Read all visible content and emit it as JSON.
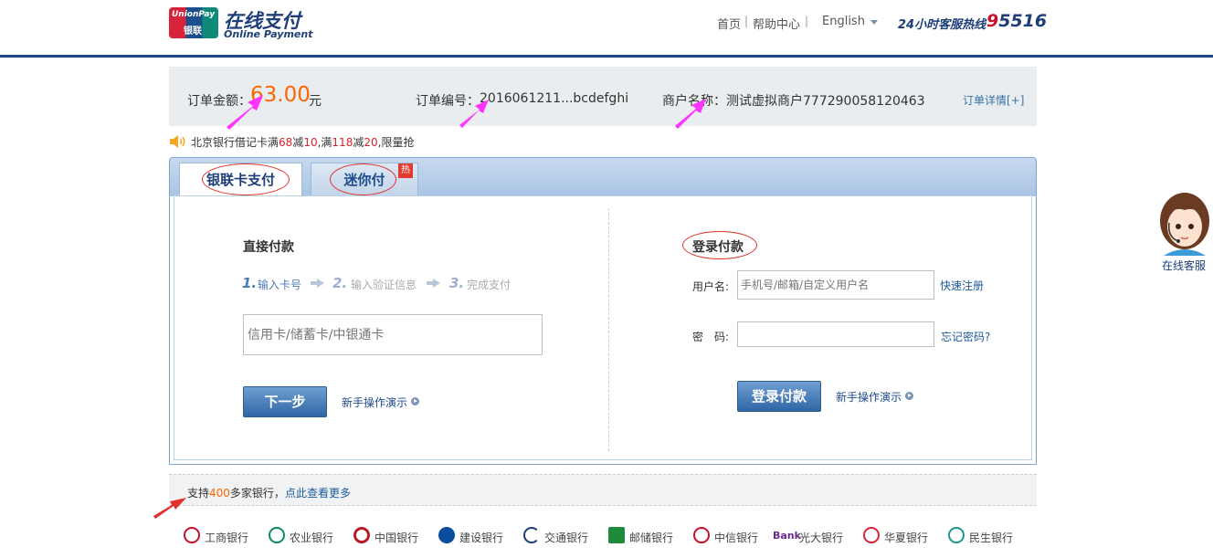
{
  "header": {
    "logo_line1": "UnionPay",
    "logo_line2": "银联",
    "brand_title": "在线支付",
    "brand_subtitle": "Online Payment",
    "nav_home": "首页",
    "nav_help": "帮助中心",
    "nav_lang": "English",
    "hotline_label": "24小时客服热线",
    "hotline_number": "95516"
  },
  "order": {
    "amount_label": "订单金额：",
    "amount_value": "63.00",
    "amount_unit": "元",
    "number_label": "订单编号：",
    "number_value": "2016061211...bcdefghi",
    "merchant_label": "商户名称：",
    "merchant_value": "测试虚拟商户777290058120463",
    "details_link": "订单详情[+]"
  },
  "promo": {
    "text_1": "北京银行借记卡满",
    "n1": "68",
    "text_2": "减",
    "n2": "10",
    "text_3": ",满",
    "n3": "118",
    "text_4": "减",
    "n4": "20",
    "text_5": ",限量抢"
  },
  "tabs": [
    {
      "label": "银联卡支付",
      "active": true
    },
    {
      "label": "迷你付",
      "active": false,
      "badge": "热"
    }
  ],
  "direct_pay": {
    "title": "直接付款",
    "steps": [
      {
        "num": "1.",
        "label": "输入卡号",
        "active": true
      },
      {
        "num": "2.",
        "label": "输入验证信息",
        "active": false
      },
      {
        "num": "3.",
        "label": "完成支付",
        "active": false
      }
    ],
    "card_placeholder": "信用卡/储蓄卡/中银通卡",
    "next_button": "下一步",
    "demo_link": "新手操作演示"
  },
  "login_pay": {
    "title": "登录付款",
    "username_label": "用户名:",
    "username_placeholder": "手机号/邮箱/自定义用户名",
    "register_link": "快速注册",
    "password_label": "密　码:",
    "forgot_link": "忘记密码?",
    "login_button": "登录付款",
    "demo_link": "新手操作演示"
  },
  "support": {
    "text_before": "支持",
    "count": "400",
    "text_after": "多家银行，",
    "more_link": "点此查看更多"
  },
  "banks": [
    {
      "name": "工商银行",
      "color": "#c8102e"
    },
    {
      "name": "农业银行",
      "color": "#0f8a5f"
    },
    {
      "name": "中国银行",
      "color": "#b81c22"
    },
    {
      "name": "建设银行",
      "color": "#0a4d9c"
    },
    {
      "name": "交通银行",
      "color": "#1d3e78"
    },
    {
      "name": "邮储银行",
      "color": "#1f8a3a"
    },
    {
      "name": "中信银行",
      "color": "#c8102e"
    },
    {
      "name": "光大银行",
      "color": "#6a2c8c",
      "prefix": "Bank"
    },
    {
      "name": "华夏银行",
      "color": "#d7243a"
    },
    {
      "name": "民生银行",
      "color": "#1b9a8a"
    }
  ],
  "agent": {
    "label": "在线客服"
  },
  "colors": {
    "brand_blue": "#1d3e78",
    "accent_orange": "#ff6600",
    "annotation_magenta": "#ff33ff",
    "annotation_red": "#e0312b"
  }
}
